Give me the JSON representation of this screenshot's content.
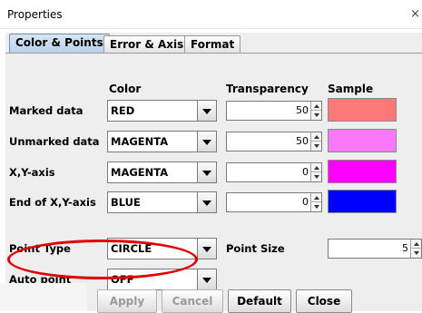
{
  "window": {
    "title": "Properties",
    "close_glyph": "×"
  },
  "tabs": [
    {
      "label": "Color & Points",
      "active": true
    },
    {
      "label": "Error & Axis",
      "active": false
    },
    {
      "label": "Format",
      "active": false
    }
  ],
  "headers": {
    "color": "Color",
    "transparency": "Transparency",
    "sample": "Sample"
  },
  "rows": [
    {
      "label": "Marked data",
      "color": "RED",
      "transparency": "50",
      "sample_color": "#fb7878"
    },
    {
      "label": "Unmarked data",
      "color": "MAGENTA",
      "transparency": "50",
      "sample_color": "#fb78fb"
    },
    {
      "label": "X,Y-axis",
      "color": "MAGENTA",
      "transparency": "0",
      "sample_color": "#ff00ff"
    },
    {
      "label": "End of X,Y-axis",
      "color": "BLUE",
      "transparency": "0",
      "sample_color": "#0000ff"
    }
  ],
  "point_type": {
    "label": "Point Type",
    "value": "CIRCLE"
  },
  "point_size": {
    "label": "Point Size",
    "value": "5"
  },
  "auto_point": {
    "label": "Auto point",
    "value": "OFF"
  },
  "buttons": {
    "apply": "Apply",
    "cancel": "Cancel",
    "default": "Default",
    "close": "Close"
  },
  "annotation_color": "#e00000",
  "icons": [
    "close-icon",
    "dropdown-arrow-icon",
    "spinner-up-icon",
    "spinner-down-icon"
  ]
}
